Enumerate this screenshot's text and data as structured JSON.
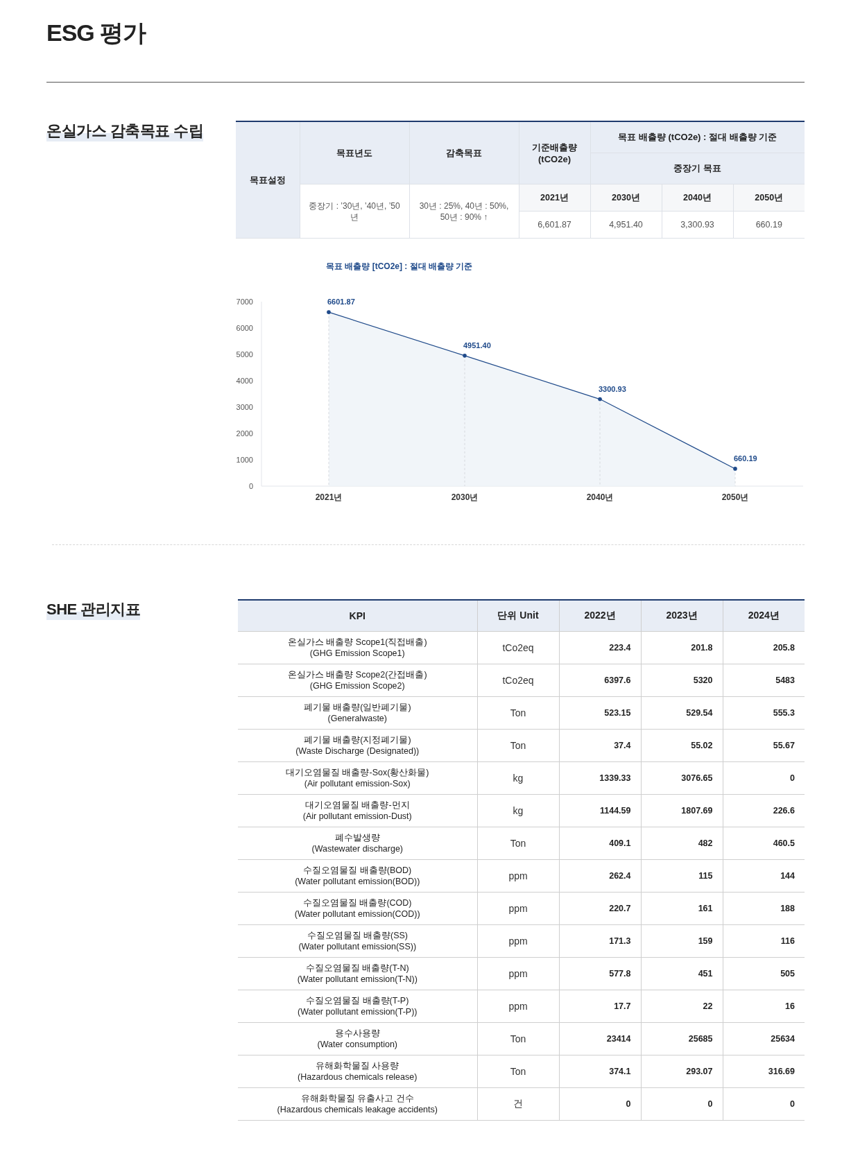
{
  "page_title": "ESG 평가",
  "ghg_target": {
    "heading": "온실가스 감축목표 수립",
    "table": {
      "row_label": "목표설정",
      "year_label": "목표년도",
      "reduction_label": "감축목표",
      "base_label": "기준배출량 (tCO2e)",
      "target_label": "목표 배출량 (tCO2e) : 절대 배출량 기준",
      "midterm_label": "중장기 목표",
      "target_years": "중장기 : ’30년, ’40년, ’50년",
      "reduction": "30년 : 25%, 40년 : 50%, 50년 : 90% ↑",
      "base": {
        "year": "2021년",
        "value": "6,601.87"
      },
      "targets": [
        {
          "year": "2030년",
          "value": "4,951.40"
        },
        {
          "year": "2040년",
          "value": "3,300.93"
        },
        {
          "year": "2050년",
          "value": "660.19"
        }
      ]
    },
    "chart_data": {
      "type": "area",
      "title": "목표 배출량 [tCO2e] : 절대 배출량 기준",
      "categories": [
        "2021년",
        "2030년",
        "2040년",
        "2050년"
      ],
      "series": [
        {
          "color": "#1f4a8a",
          "values": [
            6601.87,
            4951.4,
            3300.93,
            660.19
          ]
        }
      ],
      "value_labels": [
        "6601.87",
        "4951.40",
        "3300.93",
        "660.19"
      ],
      "ylim": [
        0,
        7000
      ],
      "yticks": [
        0,
        1000,
        2000,
        3000,
        4000,
        5000,
        6000,
        7000
      ]
    }
  },
  "she": {
    "heading": "SHE 관리지표",
    "columns": [
      "KPI",
      "단위 Unit",
      "2022년",
      "2023년",
      "2024년"
    ],
    "rows": [
      {
        "ko": "온실가스 배출량 Scope1(직접배출)",
        "en": "(GHG Emission Scope1)",
        "unit": "tCo2eq",
        "values": [
          "223.4",
          "201.8",
          "205.8"
        ]
      },
      {
        "ko": "온실가스 배출량 Scope2(간접배출)",
        "en": "(GHG Emission Scope2)",
        "unit": "tCo2eq",
        "values": [
          "6397.6",
          "5320",
          "5483"
        ]
      },
      {
        "ko": "폐기물 배출량(일반폐기물)",
        "en": "(Generalwaste)",
        "unit": "Ton",
        "values": [
          "523.15",
          "529.54",
          "555.3"
        ]
      },
      {
        "ko": "폐기물 배출량(지정폐기물)",
        "en": "(Waste Discharge (Designated))",
        "unit": "Ton",
        "values": [
          "37.4",
          "55.02",
          "55.67"
        ]
      },
      {
        "ko": "대기오염물질 배출량-Sox(황산화물)",
        "en": "(Air pollutant emission-Sox)",
        "unit": "kg",
        "values": [
          "1339.33",
          "3076.65",
          "0"
        ]
      },
      {
        "ko": "대기오염물질 배출량-먼지",
        "en": "(Air pollutant emission-Dust)",
        "unit": "kg",
        "values": [
          "1144.59",
          "1807.69",
          "226.6"
        ]
      },
      {
        "ko": "폐수발생량",
        "en": "(Wastewater discharge)",
        "unit": "Ton",
        "values": [
          "409.1",
          "482",
          "460.5"
        ]
      },
      {
        "ko": "수질오염물질 배출량(BOD)",
        "en": "(Water pollutant emission(BOD))",
        "unit": "ppm",
        "values": [
          "262.4",
          "115",
          "144"
        ]
      },
      {
        "ko": "수질오염물질 배출량(COD)",
        "en": "(Water pollutant emission(COD))",
        "unit": "ppm",
        "values": [
          "220.7",
          "161",
          "188"
        ]
      },
      {
        "ko": "수질오염물질 배출량(SS)",
        "en": "(Water pollutant emission(SS))",
        "unit": "ppm",
        "values": [
          "171.3",
          "159",
          "116"
        ]
      },
      {
        "ko": "수질오염물질 배출량(T-N)",
        "en": "(Water pollutant emission(T-N))",
        "unit": "ppm",
        "values": [
          "577.8",
          "451",
          "505"
        ]
      },
      {
        "ko": "수질오염물질 배출량(T-P)",
        "en": "(Water pollutant emission(T-P))",
        "unit": "ppm",
        "values": [
          "17.7",
          "22",
          "16"
        ]
      },
      {
        "ko": "용수사용량",
        "en": "(Water consumption)",
        "unit": "Ton",
        "values": [
          "23414",
          "25685",
          "25634"
        ]
      },
      {
        "ko": "유해화학물질 사용량",
        "en": "(Hazardous chemicals release)",
        "unit": "Ton",
        "values": [
          "374.1",
          "293.07",
          "316.69"
        ]
      },
      {
        "ko": "유해화학물질 유출사고 건수",
        "en": "(Hazardous chemicals leakage accidents)",
        "unit": "건",
        "values": [
          "0",
          "0",
          "0"
        ]
      }
    ]
  }
}
